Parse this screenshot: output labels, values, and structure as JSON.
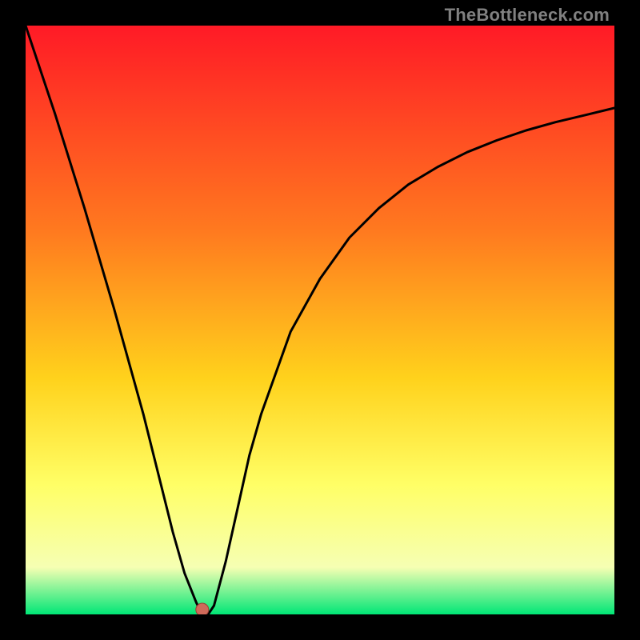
{
  "watermark": "TheBottleneck.com",
  "colors": {
    "frame_bg": "#000000",
    "gradient_top": "#ff1a26",
    "gradient_mid1": "#ff7a1f",
    "gradient_mid2": "#ffd21c",
    "gradient_mid3": "#ffff66",
    "gradient_mid4": "#f6ffb3",
    "gradient_bottom": "#00e676",
    "curve_stroke": "#000000",
    "marker_fill": "#d06a5a",
    "marker_stroke": "#9c3d33"
  },
  "chart_data": {
    "type": "line",
    "title": "",
    "xlabel": "",
    "ylabel": "",
    "xlim": [
      0,
      100
    ],
    "ylim": [
      0,
      100
    ],
    "x": [
      0,
      5,
      10,
      15,
      20,
      23,
      25,
      27,
      29,
      30,
      31,
      32,
      34,
      36,
      38,
      40,
      45,
      50,
      55,
      60,
      65,
      70,
      75,
      80,
      85,
      90,
      95,
      100
    ],
    "values": [
      100,
      85,
      69,
      52,
      34,
      22,
      14,
      7,
      2,
      0,
      0,
      1.5,
      9,
      18,
      27,
      34,
      48,
      57,
      64,
      69,
      73,
      76,
      78.5,
      80.5,
      82.2,
      83.6,
      84.8,
      86
    ],
    "min_point": {
      "x": 30,
      "y": 0
    },
    "grid": false
  }
}
